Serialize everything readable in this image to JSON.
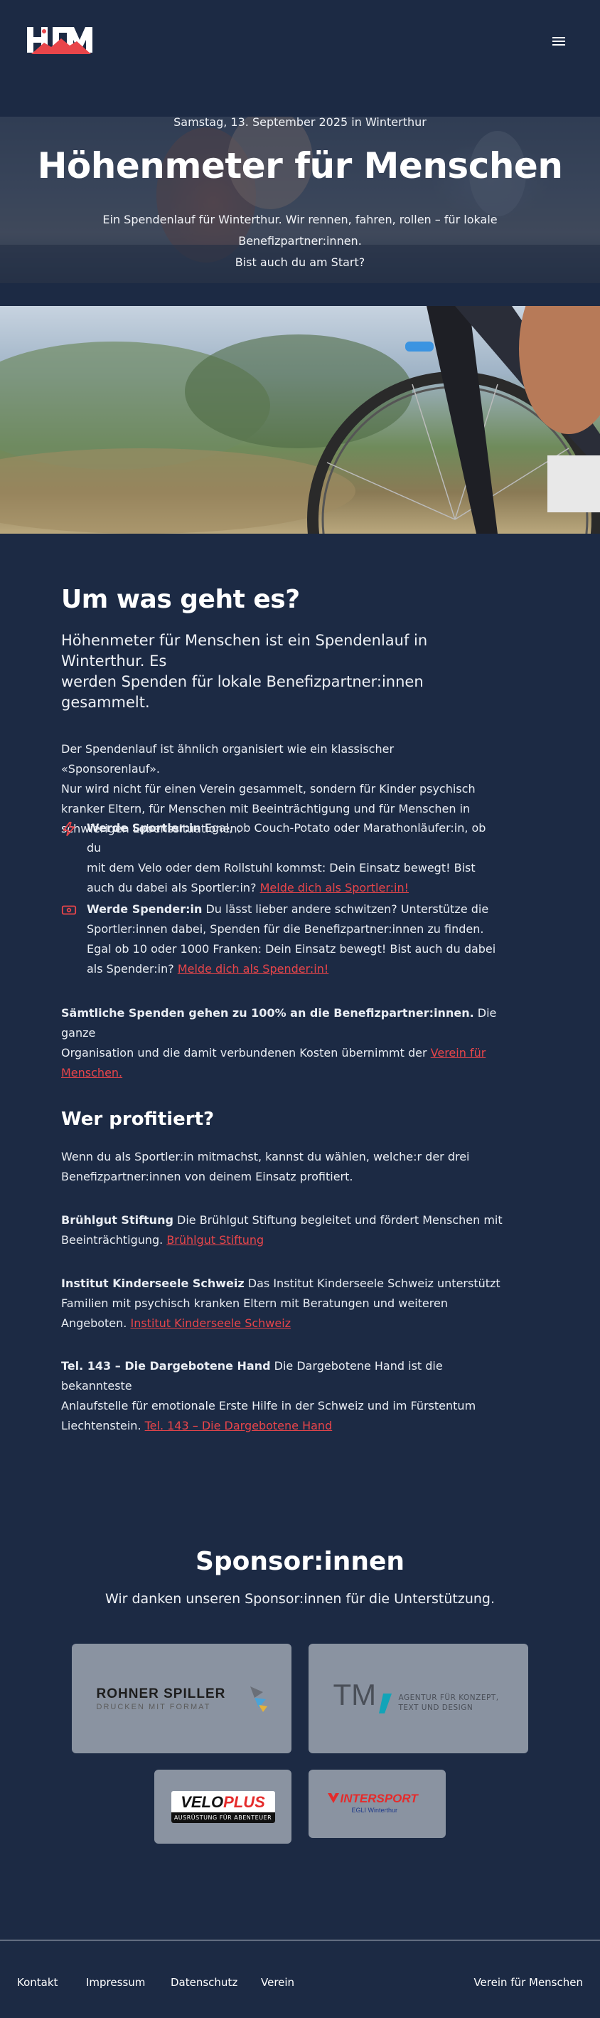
{
  "header": {
    "logo_text": "HFM",
    "menu_icon": "hamburger-icon"
  },
  "hero": {
    "date": "Samstag, 13. September 2025 in Winterthur",
    "title": "Höhenmeter für Menschen",
    "subtitle_line1": "Ein Spendenlauf für Winterthur. Wir rennen, fahren, rollen – für lokale Benefizpartner:innen.",
    "subtitle_line2": "Bist auch du am Start?"
  },
  "about": {
    "heading": "Um was geht es?",
    "lead_line1": "Höhenmeter für Menschen ist ein Spendenlauf in Winterthur. Es",
    "lead_line2": "werden Spenden für lokale Benefizpartner:innen gesammelt.",
    "para_lines": [
      "Der Spendenlauf ist ähnlich organisiert wie ein klassischer «Sponsorenlauf».",
      "Nur wird nicht für einen Verein gesammelt, sondern für Kinder psychisch",
      "kranker Eltern, für Menschen mit Beeinträchtigung und für Menschen in",
      "schwierigen Lebenssituationen."
    ],
    "athlete": {
      "icon": "lightning-icon",
      "title": "Werde Sportler:in",
      "line1": " Egal, ob Couch-Potato oder Marathonläufer:in, ob du",
      "line2": "mit dem Velo oder dem Rollstuhl kommst: Dein Einsatz bewegt! Bist",
      "line3": "auch du dabei als Sportler:in? ",
      "link": "Melde dich als Sportler:in!"
    },
    "donor": {
      "icon": "money-icon",
      "title": "Werde Spender:in",
      "line1": " Du lässt lieber andere schwitzen? Unterstütze die",
      "line2": "Sportler:innen dabei, Spenden für die Benefizpartner:innen zu finden.",
      "line3": "Egal ob 10 oder 1000 Franken: Dein Einsatz bewegt! Bist auch du dabei",
      "line4": "als Spender:in? ",
      "link": "Melde dich als Spender:in!"
    },
    "note": {
      "bold": "Sämtliche Spenden gehen zu 100% an die Benefizpartner:innen.",
      "line1_rest": " Die ganze",
      "line2": "Organisation und die damit verbundenen Kosten übernimmt der ",
      "link_part1": "Verein für",
      "link_part2": "Menschen."
    }
  },
  "beneficiaries": {
    "heading": "Wer profitiert?",
    "intro_line1": "Wenn du als Sportler:in mitmachst, kannst du wählen, welche:r der drei",
    "intro_line2": "Benefizpartner:innen von deinem Einsatz profitiert.",
    "items": [
      {
        "name": "Brühlgut Stiftung",
        "line1": " Die Brühlgut Stiftung begleitet und fördert Menschen mit",
        "line2": "Beeinträchtigung. ",
        "link": "Brühlgut Stiftung"
      },
      {
        "name": "Institut Kinderseele Schweiz",
        "line1": " Das Institut Kinderseele Schweiz unterstützt",
        "line2": "Familien mit psychisch kranken Eltern mit Beratungen und weiteren",
        "line3": "Angeboten. ",
        "link": "Institut Kinderseele Schweiz"
      },
      {
        "name": "Tel. 143 – Die Dargebotene Hand",
        "line1": " Die Dargebotene Hand ist die bekannteste",
        "line2": "Anlaufstelle für emotionale Erste Hilfe in der Schweiz und im Fürstentum",
        "line3": "Liechtenstein. ",
        "link": "Tel. 143 – Die Dargebotene Hand"
      }
    ]
  },
  "sponsors": {
    "heading": "Sponsor:innen",
    "subtitle": "Wir danken unseren Sponsor:innen für die Unterstützung.",
    "logos": [
      {
        "line1": "ROHNER SPILLER",
        "line2": "DRUCKEN MIT FORMAT"
      },
      {
        "mark": "TM",
        "line1": "AGENTUR FÜR KONZEPT,",
        "line2": "TEXT UND DESIGN"
      },
      {
        "part1": "VELO",
        "part2": "PLUS",
        "tagline": "AUSRÜSTUNG FÜR ABENTEUER"
      },
      {
        "line1": "INTERSPORT",
        "line2": "EGLI Winterthur"
      }
    ]
  },
  "footer": {
    "links": [
      "Kontakt",
      "Impressum",
      "Datenschutz",
      "Verein"
    ],
    "right": "Verein für Menschen"
  },
  "colors": {
    "background": "#1c2a44",
    "accent": "#e8454a",
    "card": "#8a93a1"
  }
}
